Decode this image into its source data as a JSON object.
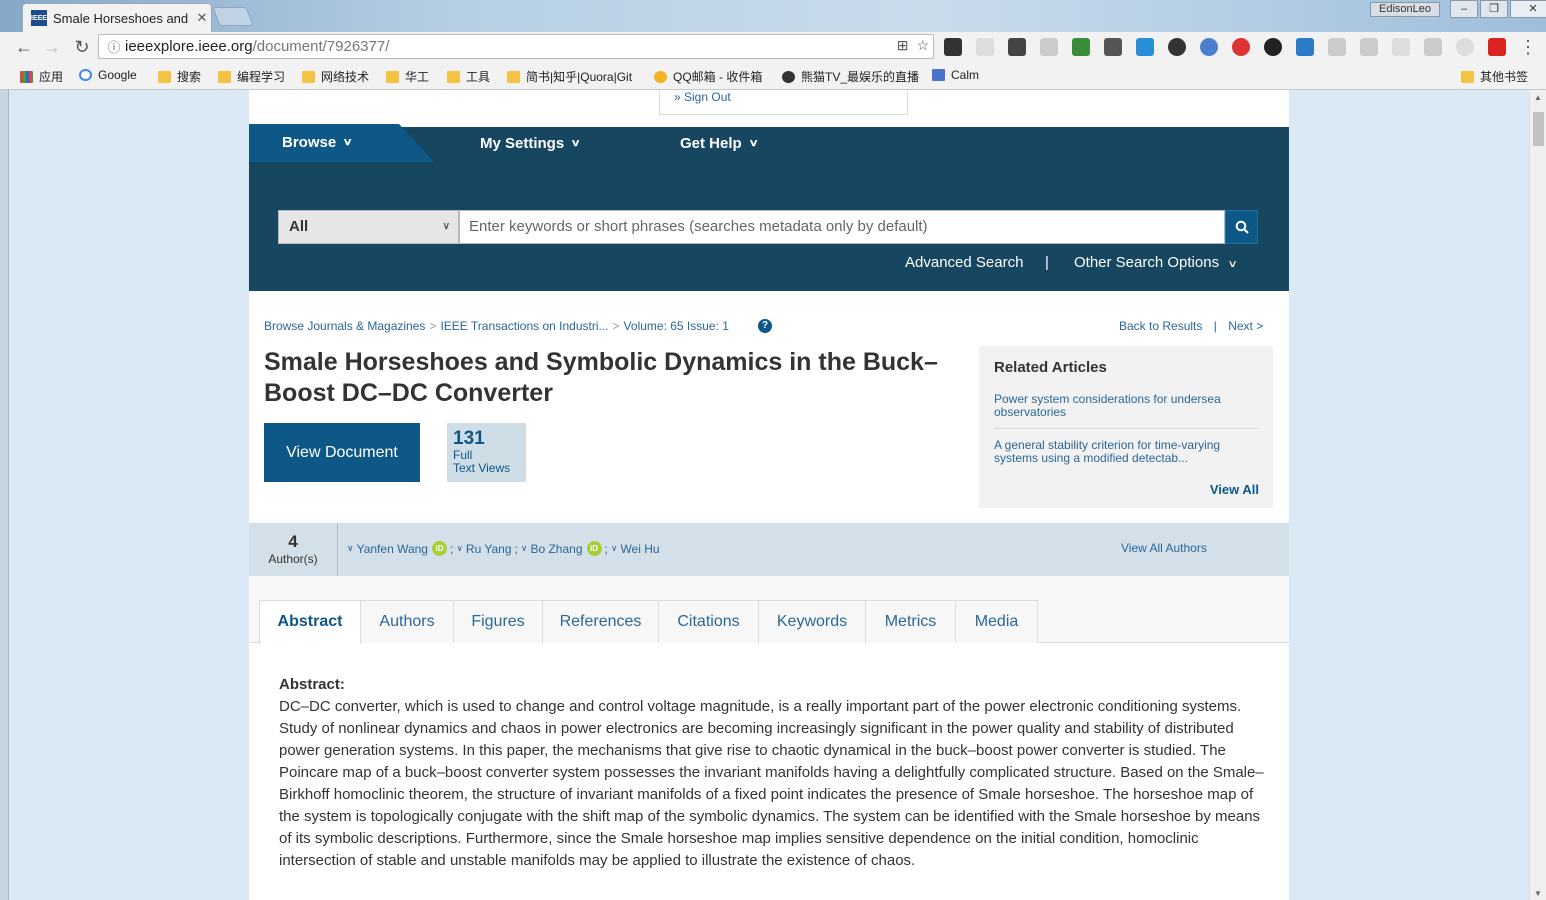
{
  "browser": {
    "tab_title": "Smale Horseshoes and",
    "tab_favicon": "IEEE",
    "user": "EdisonLeo",
    "url_host": "ieeexplore.ieee.org",
    "url_path": "/document/7926377/",
    "bookmarks": [
      "应用",
      "Google",
      "搜索",
      "编程学习",
      "网络技术",
      "华工",
      "工具",
      "简书|知乎|Quora|Git",
      "QQ邮箱 - 收件箱",
      "熊猫TV_最娱乐的直播",
      "Calm",
      "其他书签"
    ]
  },
  "site": {
    "sign_out": "» Sign Out",
    "nav": {
      "browse": "Browse",
      "settings": "My Settings",
      "help": "Get Help"
    },
    "search": {
      "scope": "All",
      "placeholder": "Enter keywords or short phrases (searches metadata only by default)",
      "advanced": "Advanced Search",
      "divider": "|",
      "other": "Other Search Options"
    }
  },
  "breadcrumb": [
    "Browse Journals & Magazines",
    "IEEE Transactions on Industri...",
    "Volume: 65 Issue: 1"
  ],
  "back_to_results": "Back to Results",
  "next": "Next >",
  "article": {
    "title": "Smale Horseshoes and Symbolic Dynamics in the Buck–Boost DC–DC Converter",
    "view_document": "View Document",
    "views_count": "131",
    "views_label_1": "Full",
    "views_label_2": "Text Views"
  },
  "related": {
    "heading": "Related Articles",
    "items": [
      "Power system considerations for undersea observatories",
      "A general stability criterion for time-varying systems using a modified detectab..."
    ],
    "view_all": "View All"
  },
  "authors": {
    "count": "4",
    "count_label": "Author(s)",
    "names": [
      "Yanfen Wang",
      "Ru Yang",
      "Bo Zhang",
      "Wei Hu"
    ],
    "view_all": "View All Authors"
  },
  "tabs": [
    "Abstract",
    "Authors",
    "Figures",
    "References",
    "Citations",
    "Keywords",
    "Metrics",
    "Media"
  ],
  "abstract": {
    "heading": "Abstract:",
    "text": "DC–DC converter, which is used to change and control voltage magnitude, is a really important part of the power electronic conditioning systems. Study of nonlinear dynamics and chaos in power electronics are becoming increasingly significant in the power quality and stability of distributed power generation systems. In this paper, the mechanisms that give rise to chaotic dynamical in the buck–boost power converter is studied. The Poincare map of a buck–boost converter system possesses the invariant manifolds having a delightfully complicated structure. Based on the Smale–Birkhoff homoclinic theorem, the structure of invariant manifolds of a fixed point indicates the presence of Smale horseshoe. The horseshoe map of the system is topologically conjugate with the shift map of the symbolic dynamics. The system can be identified with the Smale horseshoe by means of its symbolic descriptions. Furthermore, since the Smale horseshoe map implies sensitive dependence on the initial condition, homoclinic intersection of stable and unstable manifolds may be applied to illustrate the existence of chaos."
  },
  "colors": {
    "navy": "#174660",
    "brand_blue": "#0e5887",
    "link": "#2b6797",
    "orcid": "#a6ce39"
  }
}
